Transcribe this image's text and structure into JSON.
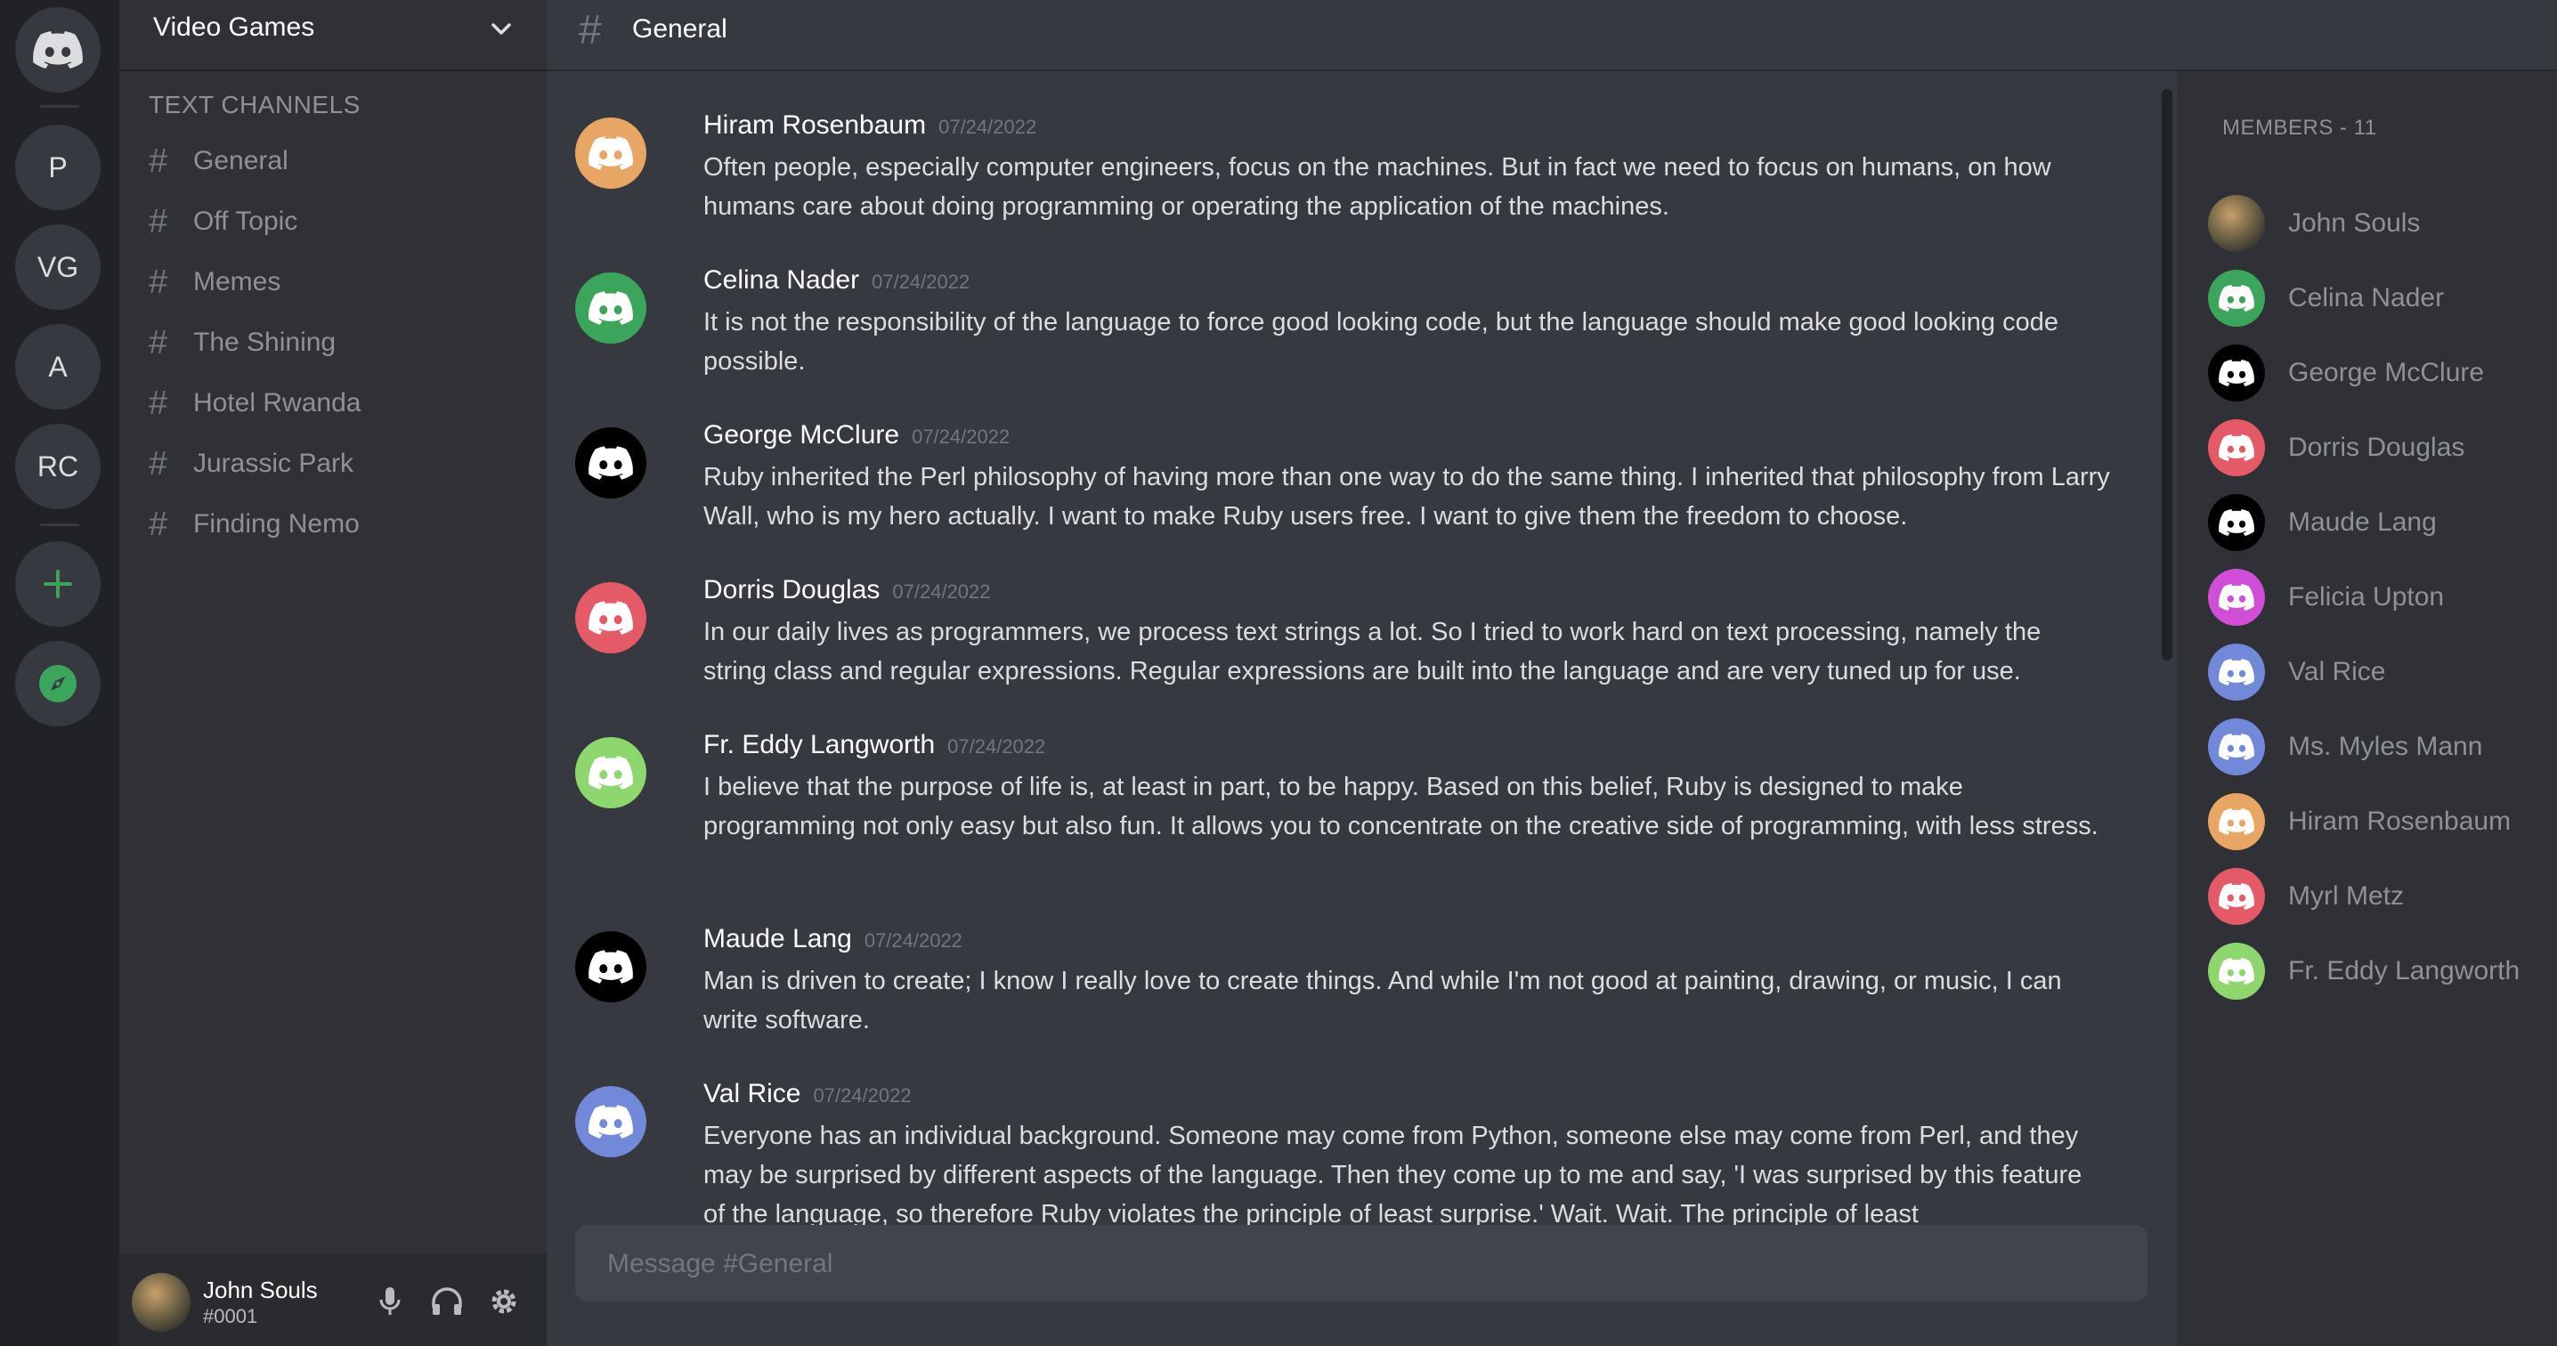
{
  "rail": {
    "servers": [
      "P",
      "VG",
      "A",
      "RC"
    ]
  },
  "sidebar": {
    "server_name": "Video Games",
    "category": "TEXT CHANNELS",
    "channels": [
      "General",
      "Off Topic",
      "Memes",
      "The Shining",
      "Hotel Rwanda",
      "Jurassic Park",
      "Finding Nemo"
    ]
  },
  "user_panel": {
    "name": "John Souls",
    "tag": "#0001"
  },
  "topbar": {
    "channel": "General"
  },
  "messages": [
    {
      "author": "Hiram Rosenbaum",
      "time": "07/24/2022",
      "color": "#e8a664",
      "text": "Often people, especially computer engineers, focus on the machines. But in fact we need to focus on humans, on how humans care about doing programming or operating the application of the machines."
    },
    {
      "author": "Celina Nader",
      "time": "07/24/2022",
      "color": "#3ba55c",
      "text": "It is not the responsibility of the language to force good looking code, but the language should make good looking code possible."
    },
    {
      "author": "George McClure",
      "time": "07/24/2022",
      "color": "#000000",
      "text": "Ruby inherited the Perl philosophy of having more than one way to do the same thing. I inherited that philosophy from Larry Wall, who is my hero actually. I want to make Ruby users free. I want to give them the freedom to choose."
    },
    {
      "author": "Dorris Douglas",
      "time": "07/24/2022",
      "color": "#e45a67",
      "text": "In our daily lives as programmers, we process text strings a lot. So I tried to work hard on text processing, namely the string class and regular expressions. Regular expressions are built into the language and are very tuned up for use."
    },
    {
      "author": "Fr. Eddy Langworth",
      "time": "07/24/2022",
      "color": "#8ed66e",
      "text": "I believe that the purpose of life is, at least in part, to be happy. Based on this belief, Ruby is designed to make programming not only easy but also fun. It allows you to concentrate on the creative side of programming, with less stress."
    },
    {
      "author": "Maude Lang",
      "time": "07/24/2022",
      "color": "#000000",
      "text": "Man is driven to create; I know I really love to create things. And while I'm not good at painting, drawing, or music, I can write software."
    },
    {
      "author": "Val Rice",
      "time": "07/24/2022",
      "color": "#7289da",
      "text": "Everyone has an individual background. Someone may come from Python, someone else may come from Perl, and they may be surprised by different aspects of the language. Then they come up to me and say, 'I was surprised by this feature of the language, so therefore Ruby violates the principle of least surprise.' Wait. Wait. The principle of least"
    }
  ],
  "composer": {
    "placeholder": "Message #General"
  },
  "members": {
    "header": "MEMBERS - 11",
    "list": [
      {
        "name": "John Souls",
        "color": "photo"
      },
      {
        "name": "Celina Nader",
        "color": "#3ba55c"
      },
      {
        "name": "George McClure",
        "color": "#000000"
      },
      {
        "name": "Dorris Douglas",
        "color": "#e45a67"
      },
      {
        "name": "Maude Lang",
        "color": "#000000"
      },
      {
        "name": "Felicia Upton",
        "color": "#d14fd8"
      },
      {
        "name": "Val Rice",
        "color": "#7289da"
      },
      {
        "name": "Ms. Myles Mann",
        "color": "#7289da"
      },
      {
        "name": "Hiram Rosenbaum",
        "color": "#e8a664"
      },
      {
        "name": "Myrl Metz",
        "color": "#e45a67"
      },
      {
        "name": "Fr. Eddy Langworth",
        "color": "#8ed66e"
      }
    ]
  }
}
